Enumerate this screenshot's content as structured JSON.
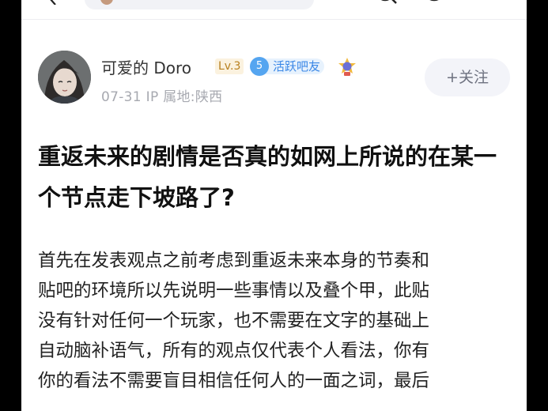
{
  "post": {
    "author": {
      "name": "可爱的 Doro",
      "level": "Lv.3",
      "active_badge_num": "5",
      "active_badge_label": "活跃吧友",
      "date": "07-31",
      "ip_location": "IP 属地:陕西"
    },
    "follow_label": "+关注",
    "title": "重返未来的剧情是否真的如网上所说的在某一个节点走下坡路了?",
    "body_lines": [
      "首先在发表观点之前考虑到重返未来本身的节奏和",
      "贴吧的环境所以先说明一些事情以及叠个甲，此贴",
      "没有针对任何一个玩家，也不需要在文字的基础上",
      "自动脑补语气，所有的观点仅代表个人看法，你有",
      "你的看法不需要盲目相信任何人的一面之词，最后"
    ]
  },
  "icons": {
    "back": "back-arrow-icon",
    "search": "search-icon",
    "more": "more-icon",
    "medal": "medal-icon"
  },
  "colors": {
    "accent_blue": "#3a87e6",
    "level_gold": "#b8801f",
    "follow_bg": "#f3f4f9"
  }
}
